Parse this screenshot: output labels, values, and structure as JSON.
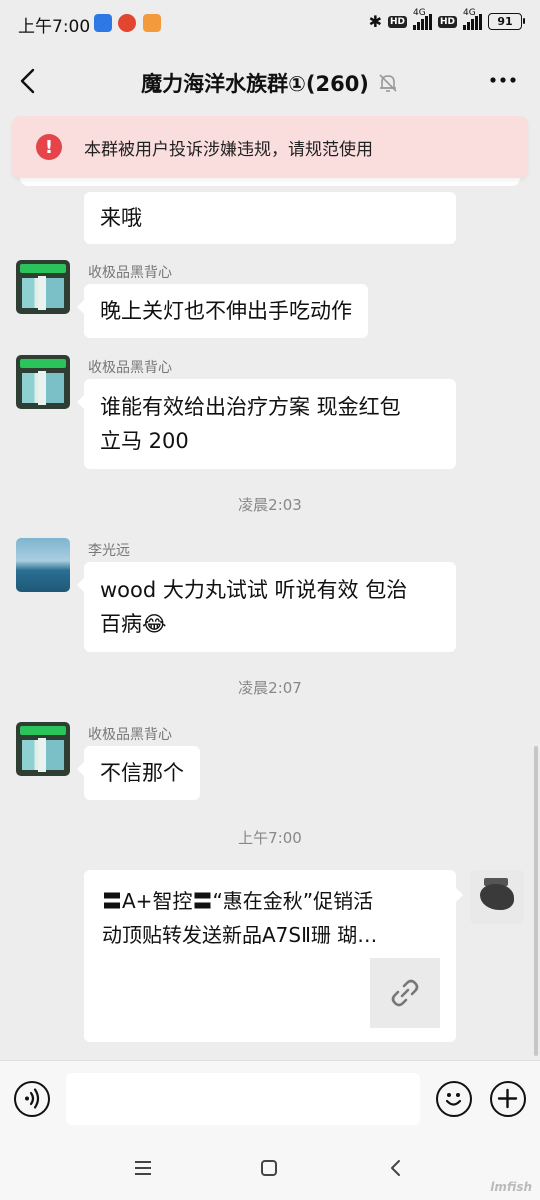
{
  "status_bar": {
    "time": "上午7:00",
    "signal_label_1": "4G",
    "signal_label_2": "4G",
    "hd_label_1": "HD",
    "hd_label_2": "HD",
    "battery": "91"
  },
  "header": {
    "title": "魔力海洋水族群①(260)"
  },
  "notice": {
    "text": "本群被用户投诉涉嫌违规，请规范使用"
  },
  "messages": [
    {
      "sender": "",
      "text": "来哦"
    },
    {
      "sender": "收极品黑背心",
      "text": "晚上关灯也不伸出手吃动作"
    },
    {
      "sender": "收极品黑背心",
      "text_line1": "谁能有效给出治疗方案 现金红包",
      "text_line2": "立马 200"
    },
    {
      "time": "凌晨2:03"
    },
    {
      "sender": "李光远",
      "text_line1": "wood 大力丸试试 听说有效 包治",
      "text_line2": "百病😂"
    },
    {
      "time": "凌晨2:07"
    },
    {
      "sender": "收极品黑背心",
      "text": "不信那个"
    },
    {
      "time": "上午7:00"
    },
    {
      "card_line1": "〓A+智控〓“惠在金秋”促销活",
      "card_line2": "动顶贴转发送新品A7SⅡ珊 瑚…"
    }
  ],
  "input": {
    "placeholder": ""
  },
  "watermark": "lmfish"
}
